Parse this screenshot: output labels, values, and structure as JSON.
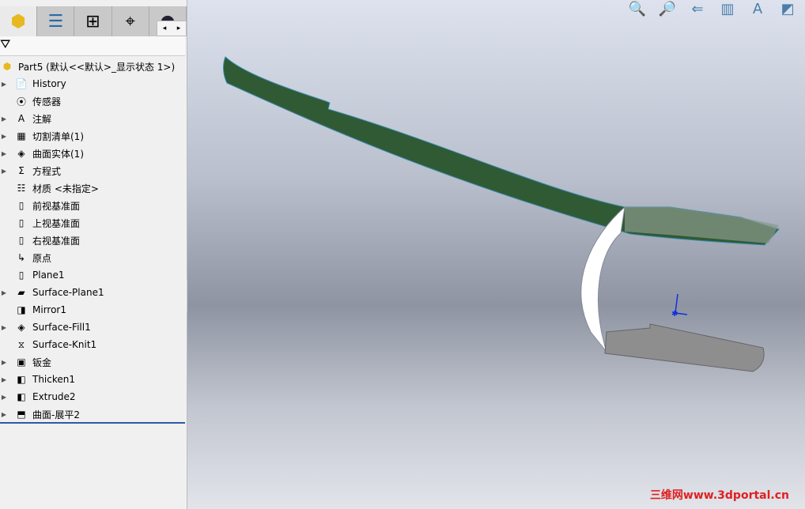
{
  "tabs": [
    {
      "icon": "feature-manager-icon"
    },
    {
      "icon": "property-manager-icon"
    },
    {
      "icon": "configuration-manager-icon"
    },
    {
      "icon": "dimxpert-icon"
    },
    {
      "icon": "display-manager-icon"
    }
  ],
  "scroll": {
    "left": "◂",
    "right": "▸"
  },
  "tree": {
    "root": "Part5  (默认<<默认>_显示状态 1>)",
    "items": [
      {
        "label": "History",
        "icon": "📄",
        "exp": true
      },
      {
        "label": "传感器",
        "icon": "⦿",
        "exp": false
      },
      {
        "label": "注解",
        "icon": "A",
        "exp": true
      },
      {
        "label": "切割清单(1)",
        "icon": "▦",
        "exp": true
      },
      {
        "label": "曲面实体(1)",
        "icon": "◈",
        "exp": true
      },
      {
        "label": "方程式",
        "icon": "Σ",
        "exp": true
      },
      {
        "label": "材质 <未指定>",
        "icon": "☷",
        "exp": false
      },
      {
        "label": "前视基准面",
        "icon": "▯",
        "exp": false
      },
      {
        "label": "上视基准面",
        "icon": "▯",
        "exp": false
      },
      {
        "label": "右视基准面",
        "icon": "▯",
        "exp": false
      },
      {
        "label": "原点",
        "icon": "↳",
        "exp": false
      },
      {
        "label": "Plane1",
        "icon": "▯",
        "exp": false
      },
      {
        "label": "Surface-Plane1",
        "icon": "▰",
        "exp": true
      },
      {
        "label": "Mirror1",
        "icon": "◨",
        "exp": false
      },
      {
        "label": "Surface-Fill1",
        "icon": "◈",
        "exp": true
      },
      {
        "label": "Surface-Knit1",
        "icon": "⧖",
        "exp": false
      },
      {
        "label": "钣金",
        "icon": "▣",
        "exp": true
      },
      {
        "label": "Thicken1",
        "icon": "◧",
        "exp": true
      },
      {
        "label": "Extrude2",
        "icon": "◧",
        "exp": true
      },
      {
        "label": "曲面-展平2",
        "icon": "⬒",
        "exp": true
      }
    ]
  },
  "toolbar": [
    "zoom-to-fit-icon",
    "zoom-to-area-icon",
    "previous-view-icon",
    "section-view-icon",
    "view-orientation-icon",
    "display-style-icon"
  ],
  "watermark": "三维网www.3dportal.cn"
}
